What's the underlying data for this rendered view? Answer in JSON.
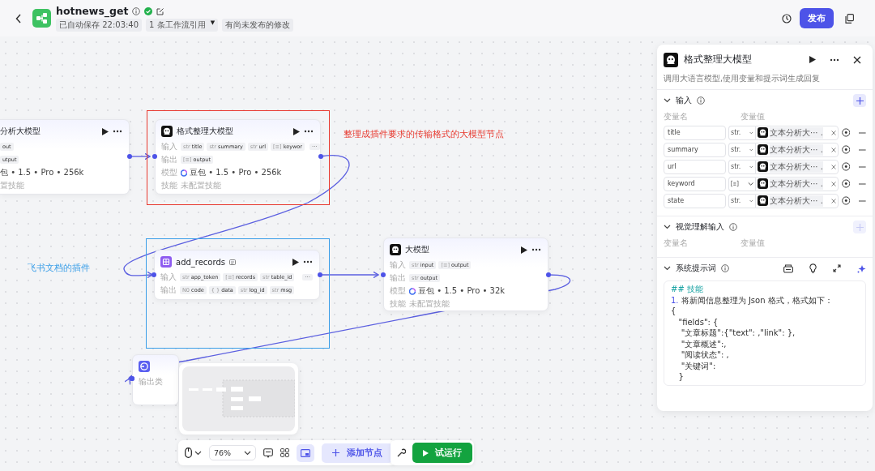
{
  "header": {
    "title": "hotnews_get",
    "tags": [
      {
        "label": "已自动保存 22:03:40"
      },
      {
        "label": "1 条工作流引用",
        "caret": "▼"
      },
      {
        "label": "有尚未发布的修改"
      }
    ],
    "publish_button": "发布"
  },
  "canvas": {
    "nodes": [
      {
        "kind": "llm",
        "title": "分析大模型",
        "rows": [
          {
            "kind": "tags",
            "tags": [
              {
                "name": "out"
              }
            ]
          },
          {
            "kind": "tags",
            "tags": [
              {
                "name": "utput"
              }
            ]
          },
          {
            "kind": "text",
            "value": "包 • 1.5 • Pro • 256k"
          },
          {
            "kind": "muted",
            "value": "置技能"
          }
        ]
      },
      {
        "kind": "llm",
        "title": "格式整理大模型",
        "rows": [
          {
            "kind": "tags",
            "label": "输入",
            "more": "···",
            "tags": [
              {
                "type": "str",
                "name": "title"
              },
              {
                "type": "str",
                "name": "summary"
              },
              {
                "type": "str",
                "name": "url"
              },
              {
                "type": "[≡]",
                "name": "keywor"
              }
            ]
          },
          {
            "kind": "tags",
            "label": "输出",
            "tags": [
              {
                "type": "[≡]",
                "name": "output"
              }
            ]
          },
          {
            "kind": "model",
            "label": "模型",
            "value": "豆包 • 1.5 • Pro • 256k"
          },
          {
            "kind": "muted",
            "label": "技能",
            "value": "未配置技能"
          }
        ]
      },
      {
        "kind": "plugin",
        "title": "add_records",
        "rows": [
          {
            "kind": "tags",
            "label": "输入",
            "more": "···",
            "tags": [
              {
                "type": "str",
                "name": "app_token"
              },
              {
                "type": "[≡]",
                "name": "records"
              },
              {
                "type": "str",
                "name": "table_id"
              }
            ]
          },
          {
            "kind": "tags",
            "label": "输出",
            "tags": [
              {
                "type": "N0",
                "name": "code"
              },
              {
                "type": "{ }",
                "name": "data"
              },
              {
                "type": "str",
                "name": "log_id"
              },
              {
                "type": "str",
                "name": "msg"
              }
            ]
          }
        ]
      },
      {
        "kind": "llm",
        "title": "大模型",
        "rows": [
          {
            "kind": "tags",
            "label": "输入",
            "tags": [
              {
                "type": "str",
                "name": "input"
              },
              {
                "type": "[≡]",
                "name": "output"
              }
            ]
          },
          {
            "kind": "tags",
            "label": "输出",
            "tags": [
              {
                "type": "str",
                "name": "output"
              }
            ]
          },
          {
            "kind": "model",
            "label": "模型",
            "value": "豆包 • 1.5 • Pro • 32k"
          },
          {
            "kind": "muted",
            "label": "技能",
            "value": "未配置技能"
          }
        ]
      },
      {
        "kind": "end",
        "rows": [
          {
            "kind": "muted",
            "value": "输出类"
          }
        ]
      }
    ],
    "annotations": [
      {
        "label": "整理成插件要求的传输格式的大模型节点",
        "color": "#e8392f"
      },
      {
        "label": "飞书文档的插件",
        "color": "#3a9ee8"
      }
    ],
    "toolbar": {
      "zoom": "76%",
      "minimap_on": true,
      "add_node": "添加节点",
      "run": "试运行"
    }
  },
  "panel": {
    "title": "格式整理大模型",
    "description": "调用大语言模型,使用变量和提示词生成回复",
    "input_section": {
      "title": "输入",
      "expanded": true,
      "columns": [
        "变量名",
        "变量值"
      ],
      "rows": [
        {
          "name": "title",
          "type": {
            "kind": "text",
            "label": "str."
          },
          "source": "文本分析大··· ."
        },
        {
          "name": "summary",
          "type": {
            "kind": "text",
            "label": "str."
          },
          "source": "文本分析大··· ."
        },
        {
          "name": "url",
          "type": {
            "kind": "text",
            "label": "str."
          },
          "source": "文本分析大··· ."
        },
        {
          "name": "keyword",
          "type": {
            "kind": "array"
          },
          "source": "文本分析大··· ."
        },
        {
          "name": "state",
          "type": {
            "kind": "text",
            "label": "str."
          },
          "source": "文本分析大··· ."
        }
      ]
    },
    "vision_section": {
      "title": "视觉理解输入",
      "expanded": true,
      "add_disabled": true,
      "columns": [
        "变量名",
        "变量值"
      ]
    },
    "prompt_section": {
      "title": "系统提示词",
      "expanded": true,
      "lines": [
        {
          "kind": "heading",
          "text": "## 技能"
        },
        {
          "kind": "list",
          "marker": "1.",
          "text": "将新闻信息整理为 Json 格式，格式如下："
        },
        {
          "kind": "code",
          "text": "{"
        },
        {
          "kind": "code",
          "text": "   \"fields\": {"
        },
        {
          "kind": "code",
          "text": "    \"文章标题\":{\"text\": ,\"link\": },"
        },
        {
          "kind": "code",
          "text": "    \"文章概述\":,"
        },
        {
          "kind": "code",
          "text": "    \"阅读状态\": ,"
        },
        {
          "kind": "code",
          "text": "    \"关键词\":"
        },
        {
          "kind": "code",
          "text": "   }"
        }
      ]
    }
  }
}
